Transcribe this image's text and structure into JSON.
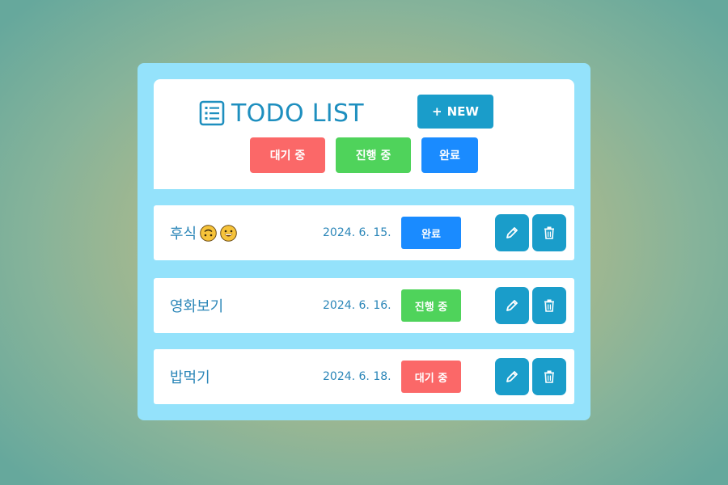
{
  "header": {
    "title": "TODO LIST",
    "title_icon": "list-icon",
    "new_button_label": "NEW",
    "new_button_icon": "plus-icon"
  },
  "filters": [
    {
      "label": "대기 중",
      "color": "#fb6868"
    },
    {
      "label": "진행 중",
      "color": "#4fd35b"
    },
    {
      "label": "완료",
      "color": "#1a8bff"
    }
  ],
  "todos": [
    {
      "title": "후식",
      "emojis": [
        "upside-down-face-emoji",
        "grinning-face-emoji"
      ],
      "date": "2024. 6. 15.",
      "status": "완료",
      "status_color": "#1a8bff"
    },
    {
      "title": "영화보기",
      "emojis": [],
      "date": "2024. 6. 16.",
      "status": "진행 중",
      "status_color": "#4fd35b"
    },
    {
      "title": "밥먹기",
      "emojis": [],
      "date": "2024. 6. 18.",
      "status": "대기 중",
      "status_color": "#fb6868"
    }
  ],
  "row_actions": {
    "edit_icon": "pencil-icon",
    "delete_icon": "trash-icon"
  },
  "colors": {
    "accent": "#1a9dca",
    "panel": "#94e2fb",
    "text": "#2b86b8"
  }
}
